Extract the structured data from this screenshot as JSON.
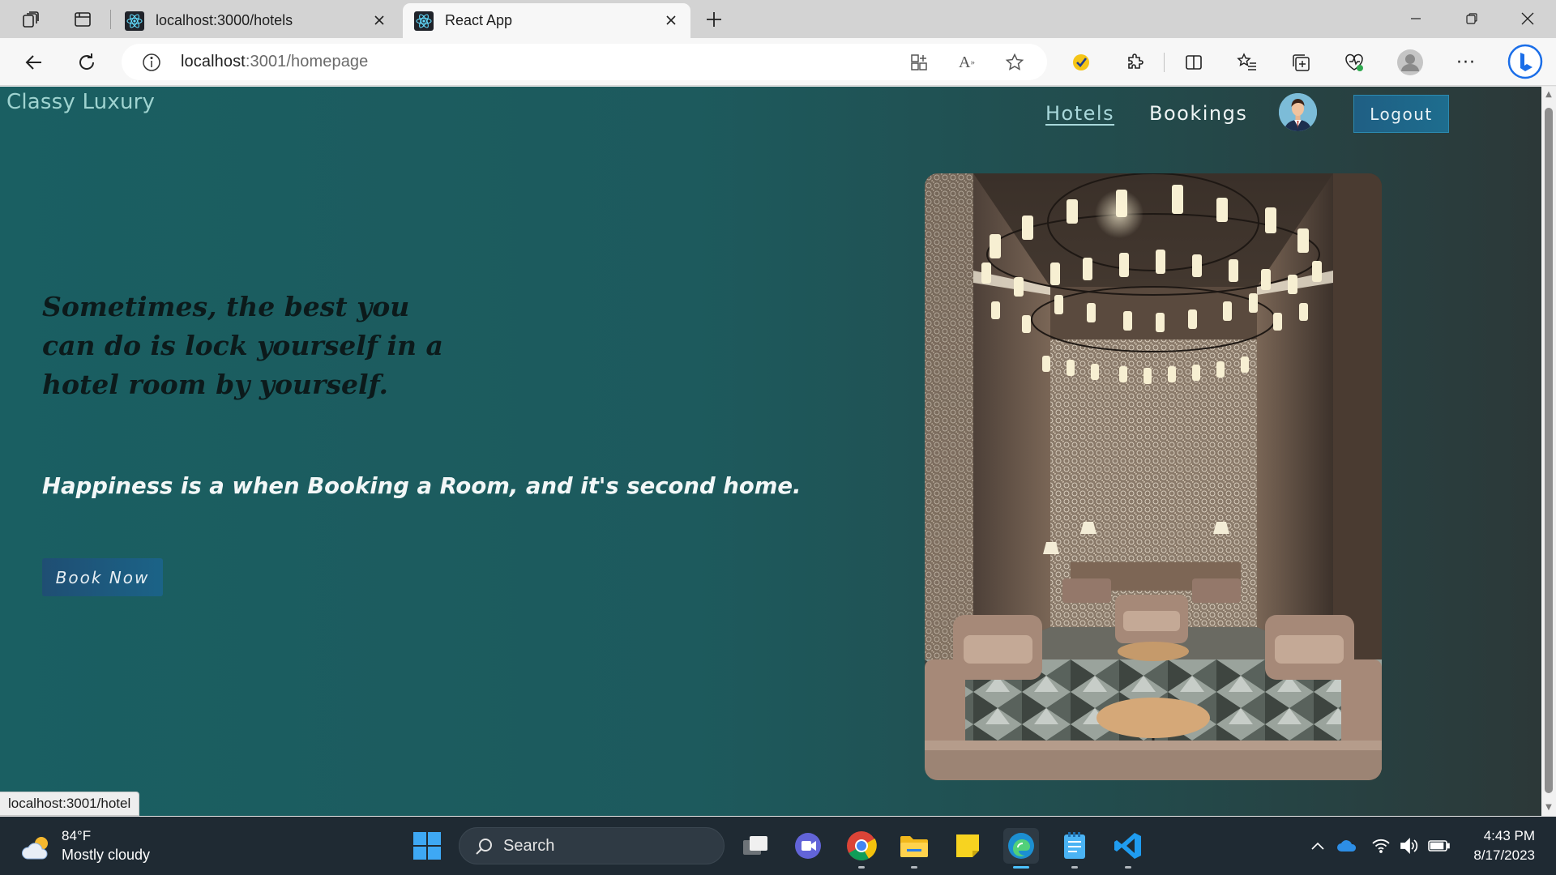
{
  "browser": {
    "tabs": [
      {
        "title": "localhost:3000/hotels",
        "active": false
      },
      {
        "title": "React App",
        "active": true
      }
    ],
    "address": {
      "host": "localhost",
      "rest": ":3001/homepage"
    },
    "status_url": "localhost:3001/hotel"
  },
  "app": {
    "brand": "Classy Luxury",
    "nav": {
      "hotels": "Hotels",
      "bookings": "Bookings",
      "logout": "Logout"
    },
    "hero": {
      "quote": "Sometimes, the best you can do is lock yourself in a hotel room by yourself.",
      "tagline": "Happiness is a when Booking a Room, and it's second home.",
      "cta": "Book Now"
    }
  },
  "taskbar": {
    "weather": {
      "temp": "84°F",
      "condition": "Mostly cloudy"
    },
    "search_label": "Search",
    "time": "4:43 PM",
    "date": "8/17/2023"
  },
  "colors": {
    "page_gradient_start": "#1a5f62",
    "page_gradient_end": "#2c3838",
    "brand": "#9fd3d0",
    "quote_text": "#0c1a1b",
    "tagline_text": "#f2f7f7",
    "button": "#1f4e73",
    "taskbar": "#1f2a33"
  }
}
